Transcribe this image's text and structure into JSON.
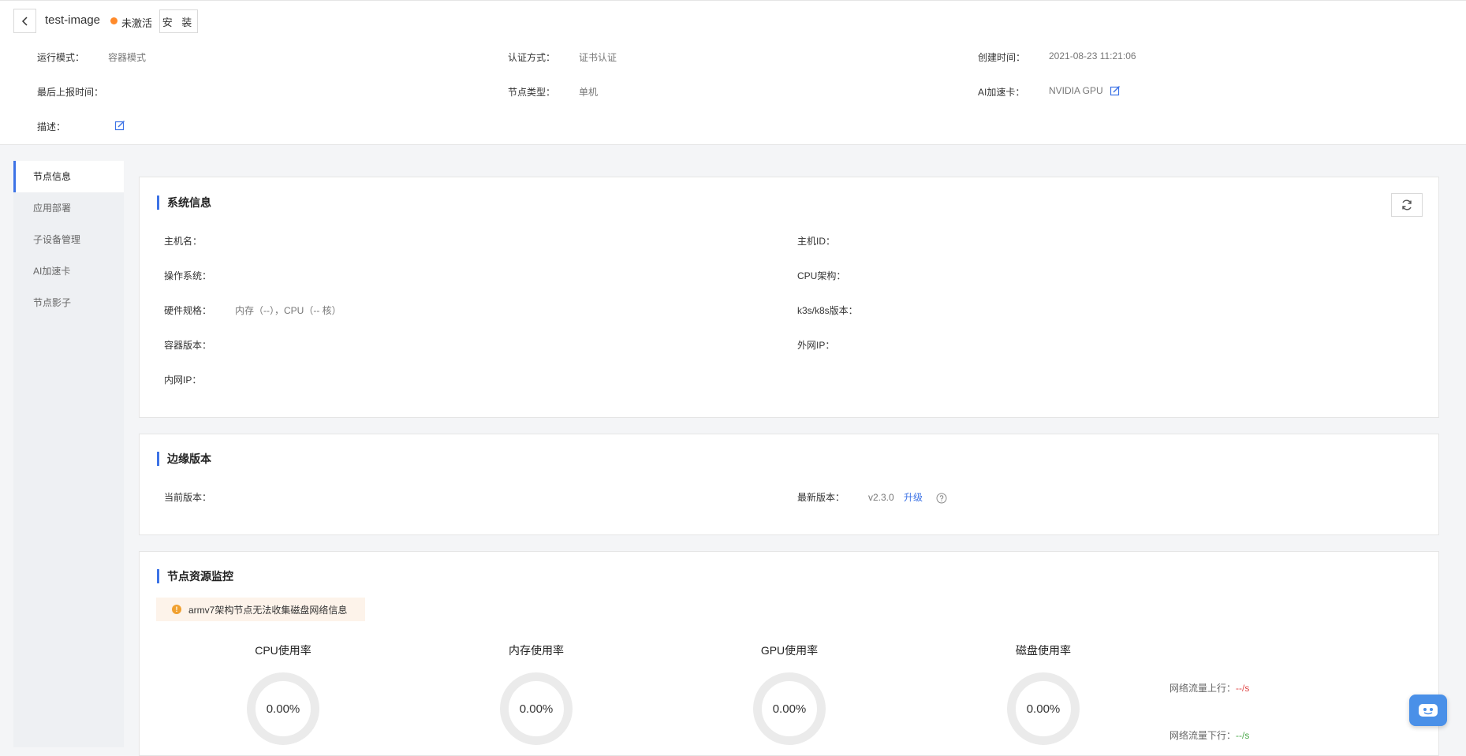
{
  "header": {
    "node_name": "test-image",
    "status": "未激活",
    "install_label": "安 装",
    "fields": {
      "run_mode_label": "运行模式：",
      "run_mode_value": "容器模式",
      "auth_label": "认证方式：",
      "auth_value": "证书认证",
      "created_label": "创建时间：",
      "created_value": "2021-08-23 11:21:06",
      "last_report_label": "最后上报时间：",
      "last_report_value": "",
      "node_type_label": "节点类型：",
      "node_type_value": "单机",
      "ai_card_label": "AI加速卡：",
      "ai_card_value": "NVIDIA GPU",
      "desc_label": "描述：",
      "desc_value": ""
    }
  },
  "sidebar": {
    "items": [
      {
        "label": "节点信息",
        "active": true
      },
      {
        "label": "应用部署",
        "active": false
      },
      {
        "label": "子设备管理",
        "active": false
      },
      {
        "label": "AI加速卡",
        "active": false
      },
      {
        "label": "节点影子",
        "active": false
      }
    ]
  },
  "system_info": {
    "title": "系统信息",
    "hostname_label": "主机名：",
    "hostname_value": "",
    "host_id_label": "主机ID：",
    "host_id_value": "",
    "os_label": "操作系统：",
    "os_value": "",
    "cpu_arch_label": "CPU架构：",
    "cpu_arch_value": "",
    "hardware_label": "硬件规格：",
    "hardware_value": "内存（--），CPU（-- 核）",
    "k8s_label": "k3s/k8s版本：",
    "k8s_value": "",
    "container_label": "容器版本：",
    "container_value": "",
    "public_ip_label": "外网IP：",
    "public_ip_value": "",
    "private_ip_label": "内网IP：",
    "private_ip_value": ""
  },
  "edge_version": {
    "title": "边缘版本",
    "current_label": "当前版本：",
    "current_value": "",
    "latest_label": "最新版本：",
    "latest_value": "v2.3.0",
    "upgrade_label": "升级"
  },
  "monitor": {
    "title": "节点资源监控",
    "warning": "armv7架构节点无法收集磁盘网络信息",
    "gauges": [
      {
        "title": "CPU使用率",
        "value": "0.00%"
      },
      {
        "title": "内存使用率",
        "value": "0.00%"
      },
      {
        "title": "GPU使用率",
        "value": "0.00%"
      },
      {
        "title": "磁盘使用率",
        "value": "0.00%"
      }
    ],
    "net_up_label": "网络流量上行：",
    "net_up_value": "--/s",
    "net_down_label": "网络流量下行：",
    "net_down_value": "--/s"
  },
  "colors": {
    "accent": "#3d73e6",
    "status_inactive": "#ff8a2a",
    "warning_bg": "#fdf3ea",
    "net_up": "#e04848",
    "net_down": "#4aa84a"
  }
}
